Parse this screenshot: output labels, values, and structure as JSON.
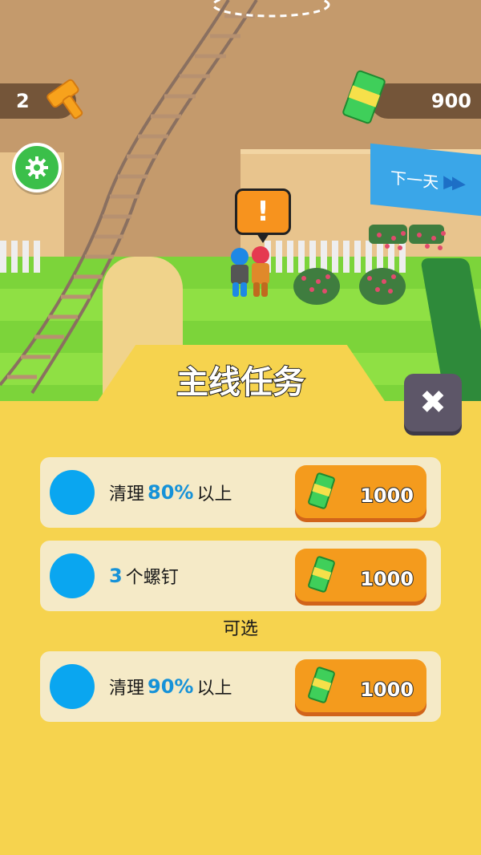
{
  "hud": {
    "bolt_count": "2",
    "cash_amount": "900",
    "next_day_label": "下一天"
  },
  "alert_mark": "!",
  "panel": {
    "title": "主线任务",
    "close_symbol": "✖",
    "optional_label": "可选"
  },
  "tasks": [
    {
      "prefix": "清理",
      "highlight": "80%",
      "suffix": "以上",
      "reward": "1000"
    },
    {
      "prefix": "",
      "highlight": "3",
      "suffix": "个螺钉",
      "reward": "1000"
    },
    {
      "prefix": "清理",
      "highlight": "90%",
      "suffix": "以上",
      "reward": "1000"
    }
  ],
  "colors": {
    "panel_bg": "#f6d34e",
    "reward_button": "#f49b1d",
    "task_dot": "#0aa6f0",
    "highlight_text": "#1692d8",
    "gear_button": "#3bbf4a",
    "next_day_button": "#3aa6e8"
  }
}
